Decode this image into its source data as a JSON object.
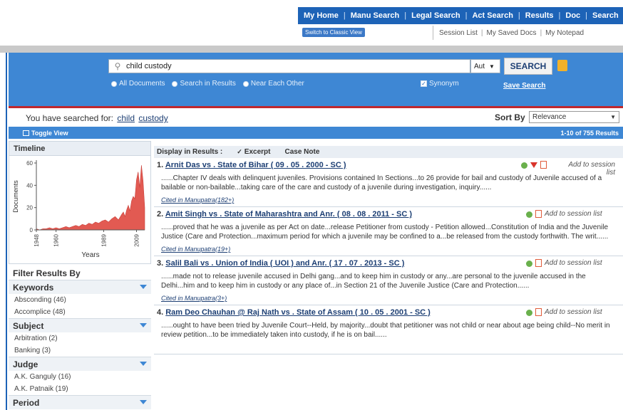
{
  "topnav": {
    "items": [
      "My Home",
      "Manu Search",
      "Legal Search",
      "Act Search",
      "Results",
      "Doc",
      "Search"
    ],
    "separator": "|"
  },
  "classic_view": "Switch to Classic View",
  "subnav": {
    "items": [
      "Session List",
      "My Saved Docs",
      "My Notepad"
    ],
    "separator": "|"
  },
  "search": {
    "query": "child custody",
    "mode": "Aut",
    "button": "SEARCH",
    "options": [
      "All Documents",
      "Search in Results",
      "Near Each Other"
    ],
    "synonym": "Synonym",
    "save_search": "Save Search"
  },
  "searched": {
    "prefix": "You have searched for:",
    "terms": [
      "child",
      "custody"
    ]
  },
  "sort": {
    "label": "Sort By",
    "value": "Relevance"
  },
  "toolbar": {
    "toggle_view": "Toggle View",
    "count": "1-10 of 755 Results"
  },
  "sidebar": {
    "timeline_title": "Timeline",
    "filter_title": "Filter Results By",
    "facets": [
      {
        "name": "Keywords",
        "items": [
          "Absconding (46)",
          "Accomplice (48)"
        ]
      },
      {
        "name": "Subject",
        "items": [
          "Arbitration (2)",
          "Banking (3)"
        ]
      },
      {
        "name": "Judge",
        "items": [
          "A.K. Ganguly (16)",
          "A.K. Patnaik (19)"
        ]
      },
      {
        "name": "Period",
        "items": []
      }
    ]
  },
  "display": {
    "label": "Display in Results :",
    "excerpt": "Excerpt",
    "case_note": "Case Note"
  },
  "add_label": "Add to session list",
  "results": [
    {
      "num": "1.",
      "title": "Arnit Das vs . State of Bihar ( 09 . 05 . 2000 - SC )",
      "excerpt": "......Chapter IV deals with delinquent juveniles. Provisions contained In Sections...to 26 provide for bail and custody of Juvenile accused of a bailable or non-bailable...taking care of the care and custody of a juvenile during investigation, inquiry......",
      "cited": "Cited in Manupatra(182+)",
      "flag": true
    },
    {
      "num": "2.",
      "title": "Amit Singh vs . State of Maharashtra and Anr. ( 08 . 08 . 2011 - SC )",
      "excerpt": "......proved that he was a juvenile as per Act on date...release Petitioner from custody - Petition allowed...Constitution of India and the Juvenile Justice (Care and Protection...maximum period for which a juvenile may be confined to a...be released from the custody forthwith. The writ......",
      "cited": "Cited in Manupatra(19+)",
      "flag": false
    },
    {
      "num": "3.",
      "title": "Salil Bali vs . Union of India ( UOI ) and Anr. ( 17 . 07 . 2013 - SC )",
      "excerpt": "......made not to release juvenile accused in Delhi gang...and to keep him in custody or any...are personal to the juvenile accused in the Delhi...him and to keep him in custody or any place of...in Section 21 of the Juvenile Justice (Care and Protection......",
      "cited": "Cited in Manupatra(3+)",
      "flag": false
    },
    {
      "num": "4.",
      "title": "Ram Deo Chauhan @ Raj Nath vs . State of Assam ( 10 . 05 . 2001 - SC )",
      "excerpt": "......ought to have been tried by Juvenile Court--Held, by majority...doubt that petitioner was not child or near about age being child--No merit in review petition...to be immediately taken into custody, if he is on bail......",
      "cited": "",
      "flag": false
    }
  ],
  "chart_data": {
    "type": "area",
    "title": "",
    "xlabel": "Years",
    "ylabel": "Documents",
    "x_ticks": [
      "1948",
      "1960",
      "1989",
      "2009"
    ],
    "y_ticks": [
      0,
      20,
      40,
      60
    ],
    "ylim": [
      0,
      60
    ],
    "xlim": [
      1948,
      2014
    ],
    "x": [
      1948,
      1950,
      1952,
      1954,
      1956,
      1958,
      1960,
      1962,
      1964,
      1966,
      1968,
      1970,
      1972,
      1974,
      1976,
      1978,
      1980,
      1982,
      1984,
      1986,
      1988,
      1990,
      1992,
      1994,
      1996,
      1998,
      2000,
      2001,
      2002,
      2003,
      2004,
      2005,
      2006,
      2007,
      2008,
      2009,
      2010,
      2011,
      2012,
      2013,
      2014
    ],
    "values": [
      1,
      0,
      1,
      1,
      2,
      1,
      2,
      1,
      2,
      3,
      2,
      3,
      4,
      3,
      5,
      4,
      6,
      5,
      7,
      6,
      8,
      9,
      7,
      10,
      12,
      9,
      14,
      16,
      12,
      18,
      22,
      17,
      26,
      30,
      28,
      45,
      52,
      38,
      58,
      44,
      20
    ],
    "color": "#e25a52"
  }
}
